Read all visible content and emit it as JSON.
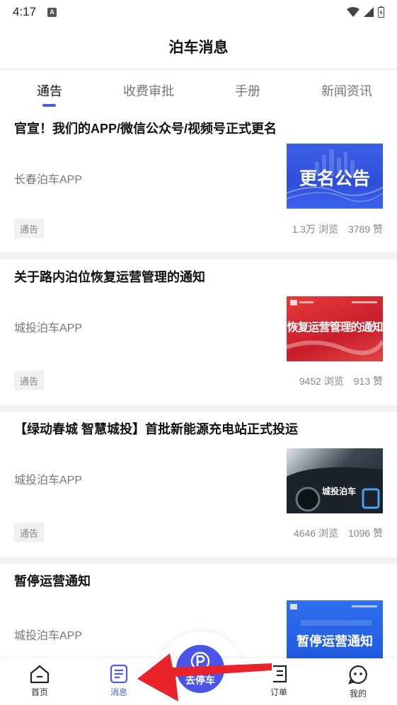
{
  "status_bar": {
    "time": "4:17",
    "notification_badge": "A"
  },
  "header": {
    "title": "泊车消息"
  },
  "tabs": [
    {
      "label": "通告",
      "active": true
    },
    {
      "label": "收费审批",
      "active": false
    },
    {
      "label": "手册",
      "active": false
    },
    {
      "label": "新闻资讯",
      "active": false
    }
  ],
  "articles": [
    {
      "title": "官宣！我们的APP/微信公众号/视频号正式更名",
      "source": "长春泊车APP",
      "tag": "通告",
      "views": "1.3万 浏览",
      "likes": "3789 赞",
      "thumb_text": "更名公告"
    },
    {
      "title": "关于路内泊位恢复运营管理的通知",
      "source": "城投泊车APP",
      "tag": "通告",
      "views": "9452 浏览",
      "likes": "913 赞",
      "thumb_text": "恢复运营管理的通知"
    },
    {
      "title": "【绿动春城 智慧城投】首批新能源充电站正式投运",
      "source": "城投泊车APP",
      "tag": "通告",
      "views": "4646 浏览",
      "likes": "1096 赞",
      "thumb_text": "城投泊车"
    },
    {
      "title": "暂停运营通知",
      "source": "城投泊车APP",
      "thumb_text": "暂停运营通知"
    }
  ],
  "bottom_nav": {
    "home": "首页",
    "messages": "消息",
    "park": "去停车",
    "orders": "订单",
    "mine": "我的"
  },
  "colors": {
    "accent": "#4a5cf0",
    "annotation_arrow": "#e8232a"
  }
}
